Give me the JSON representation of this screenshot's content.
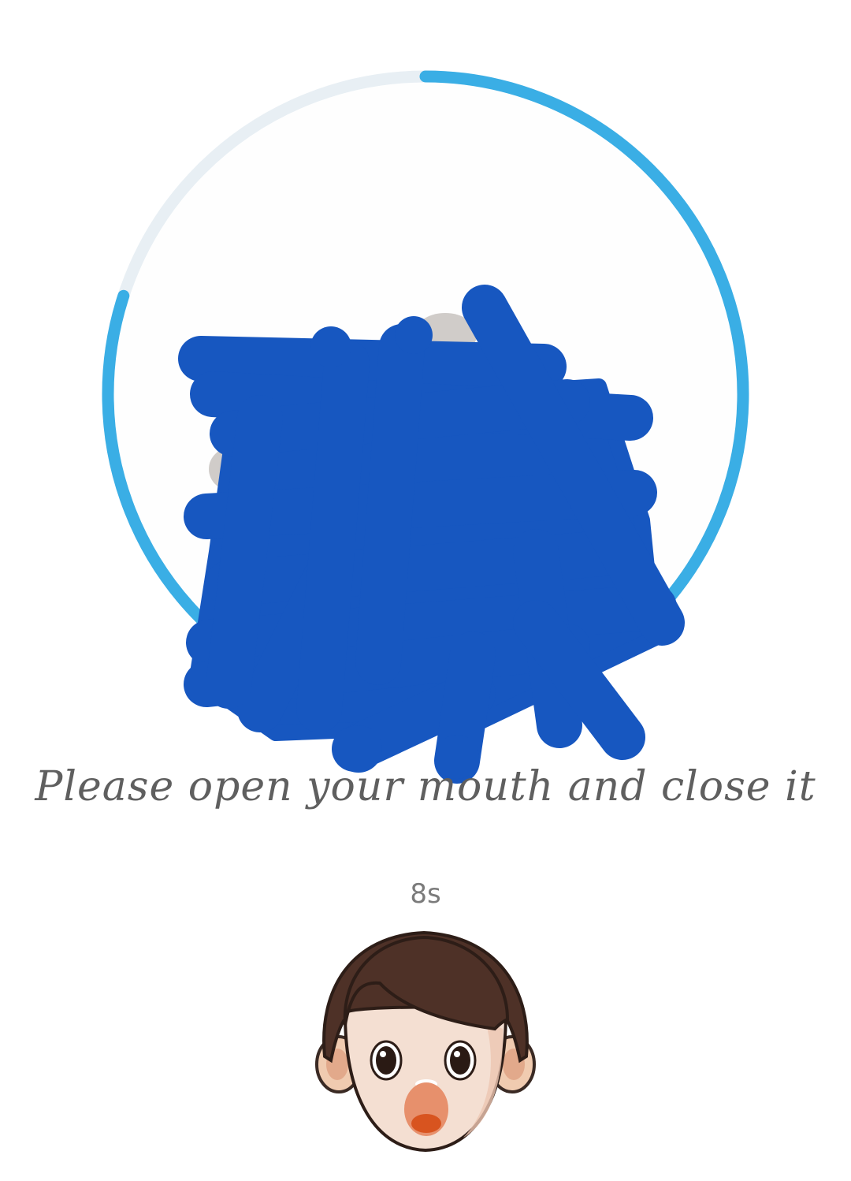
{
  "liveness": {
    "instruction": "Please open your mouth and close it",
    "countdown": "8s",
    "progress": 0.8,
    "colors": {
      "progress_active": "#3aaee5",
      "progress_track": "#e8eff4",
      "redaction": "#1757c0",
      "instruction_text": "#5f5f5f",
      "countdown_text": "#7b7b7b"
    },
    "action_icon": "open-mouth-face-icon"
  }
}
